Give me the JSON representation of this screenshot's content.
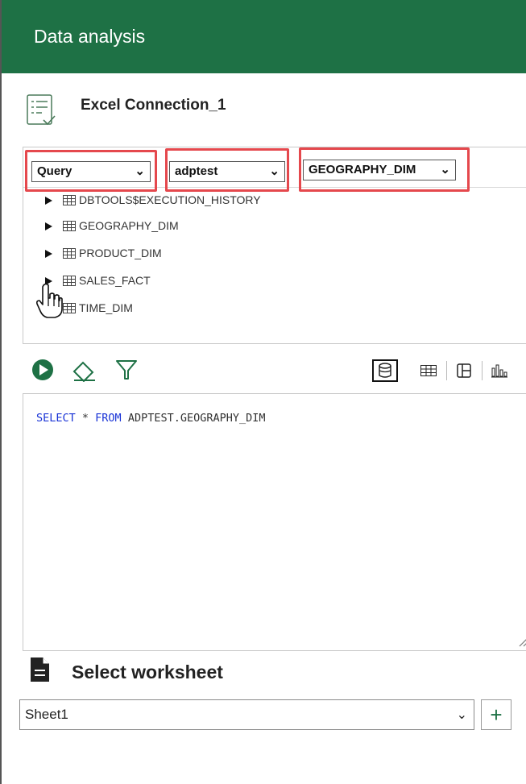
{
  "header": {
    "title": "Data analysis"
  },
  "connection": {
    "title": "Excel Connection_1",
    "icon": "connection-list-icon"
  },
  "selectors": {
    "mode": {
      "value": "Query"
    },
    "schema": {
      "value": "adptest"
    },
    "table": {
      "value": "GEOGRAPHY_DIM"
    }
  },
  "tree": {
    "items": [
      {
        "label": "DBTOOLS$EXECUTION_HISTORY"
      },
      {
        "label": "GEOGRAPHY_DIM"
      },
      {
        "label": "PRODUCT_DIM"
      },
      {
        "label": "SALES_FACT"
      },
      {
        "label": "TIME_DIM"
      }
    ]
  },
  "toolbar": {
    "run_icon": "play-icon",
    "clear_icon": "eraser-icon",
    "filter_icon": "filter-icon",
    "views": [
      "database-view-icon",
      "table-view-icon",
      "layout-view-icon",
      "chart-view-icon"
    ]
  },
  "editor": {
    "sql_kw1": "SELECT",
    "sql_star": " * ",
    "sql_kw2": "FROM",
    "sql_rest": " ADPTEST.GEOGRAPHY_DIM"
  },
  "worksheet": {
    "title": "Select worksheet",
    "value": "Sheet1",
    "add_label": "+"
  },
  "colors": {
    "brand": "#1e7145",
    "highlight": "#e5484d",
    "keyword": "#1a34d6"
  }
}
